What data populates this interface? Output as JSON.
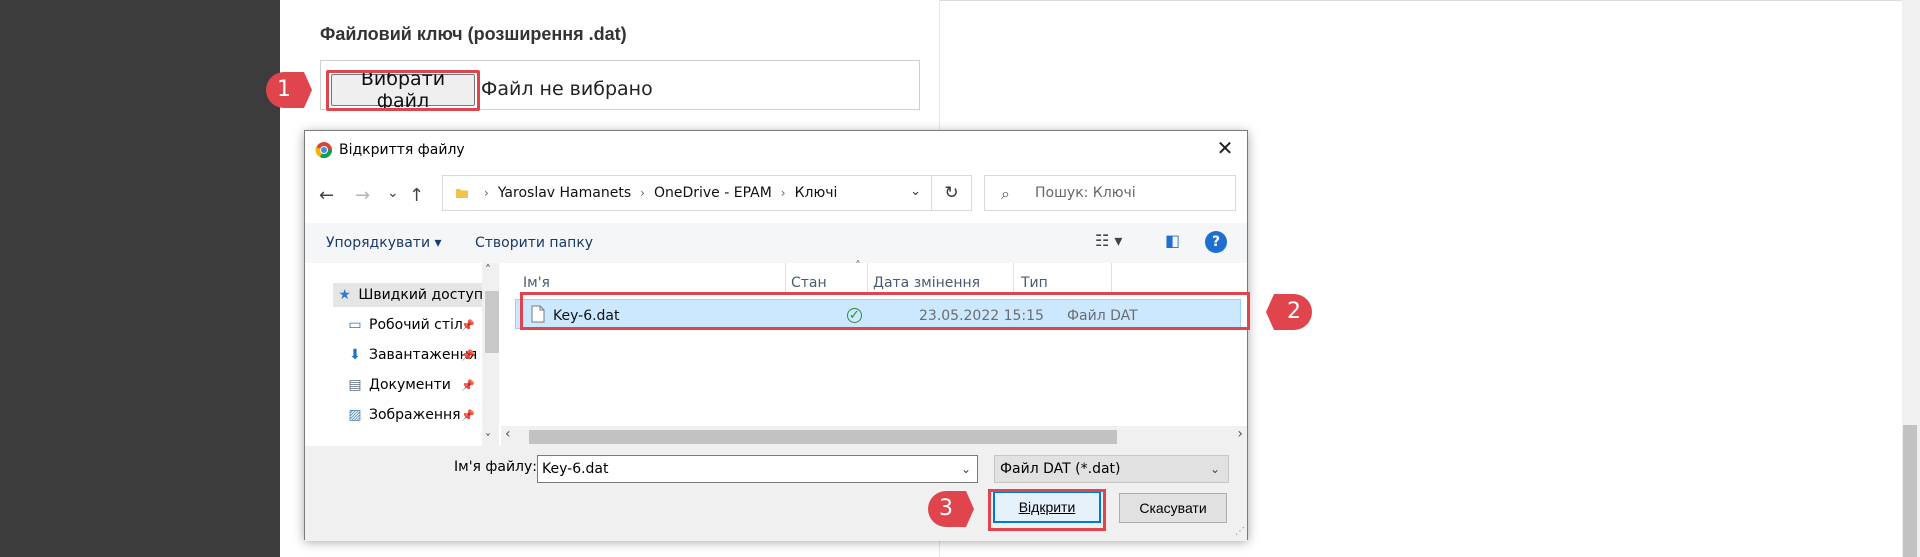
{
  "page": {
    "heading": "Файловий ключ (розширення .dat)",
    "choose_button": "Вибрати файл",
    "no_file_text": "Файл не вибрано"
  },
  "markers": {
    "m1": "1",
    "m2": "2",
    "m3": "3"
  },
  "dialog": {
    "title": "Відкриття файлу",
    "close": "✕",
    "nav": {
      "back": "←",
      "forward": "→",
      "recent": "⌄",
      "up": "↑"
    },
    "address": {
      "crumbs": [
        "Yaroslav Hamanets",
        "OneDrive - EPAM",
        "Ключі"
      ],
      "dropdown": "⌄",
      "refresh": "↻"
    },
    "search": {
      "placeholder": "Пошук: Ключі",
      "icon": "⌕"
    },
    "toolbar": {
      "organize": "Упорядкувати ▾",
      "new_folder": "Створити папку",
      "view_icon": "☷ ▾",
      "pane_icon": "◧",
      "help": "?"
    },
    "nav_pane": {
      "items": [
        {
          "label": "Швидкий доступ",
          "icon": "★"
        },
        {
          "label": "Робочий стіл",
          "icon": "▭"
        },
        {
          "label": "Завантаження",
          "icon": "⬇"
        },
        {
          "label": "Документи",
          "icon": "▤"
        },
        {
          "label": "Зображення",
          "icon": "▨"
        }
      ],
      "pin": "📌",
      "scroll_up": "˄",
      "scroll_down": "˅"
    },
    "columns": {
      "name": "Ім'я",
      "status": "Стан",
      "modified": "Дата змінення",
      "type": "Тип"
    },
    "sort_arrow": "˄",
    "files": [
      {
        "name": "Key-6.dat",
        "status": "✓",
        "modified": "23.05.2022 15:15",
        "type": "Файл DAT",
        "selected": true
      }
    ],
    "hscroll": {
      "left": "‹",
      "right": "›"
    },
    "file_name_label": "Ім'я файлу:",
    "file_name_value": "Key-6.dat",
    "file_type_value": "Файл DAT (*.dat)",
    "open_button": "Відкрити",
    "cancel_button": "Скасувати"
  }
}
